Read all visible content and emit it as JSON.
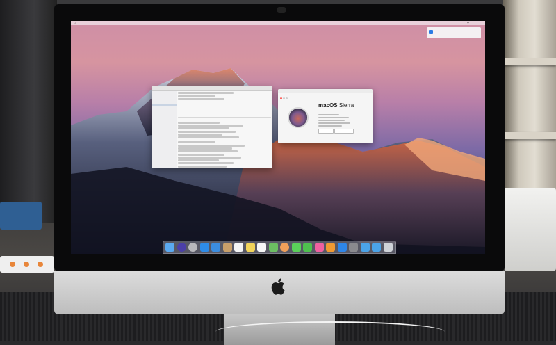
{
  "scene": {
    "device": "iMac",
    "os_name": "macOS",
    "os_version_name": "Sierra"
  },
  "about_window": {
    "os_name": "macOS",
    "os_version_name": "Sierra"
  },
  "dock": {
    "icons": [
      "finder-icon",
      "siri-icon",
      "launchpad-icon",
      "safari-icon",
      "mail-icon",
      "contacts-icon",
      "calendar-icon",
      "notes-icon",
      "reminders-icon",
      "maps-icon",
      "photos-icon",
      "messages-icon",
      "facetime-icon",
      "itunes-icon",
      "ibooks-icon",
      "app-store-icon",
      "system-preferences-icon",
      "folder-icon",
      "downloads-icon",
      "trash-icon"
    ],
    "colors": [
      "#5aa9f0",
      "#4b3fa8",
      "#b8b8bc",
      "#2e8ce8",
      "#3b8de0",
      "#c9a06a",
      "#f4f4f4",
      "#f2d45a",
      "#f7f7f7",
      "#6cbf62",
      "#f0a05a",
      "#5ad05a",
      "#4ec04e",
      "#f060a0",
      "#f09a32",
      "#2e86e8",
      "#8a8a8e",
      "#4ba3e8",
      "#4ba3e8",
      "#cfd3d8"
    ]
  },
  "colors": {
    "wallpaper_top": "#cf8fa6",
    "wallpaper_bottom": "#2c3458",
    "bezel": "#0a0a0b",
    "chin": "#d0d0d0"
  }
}
